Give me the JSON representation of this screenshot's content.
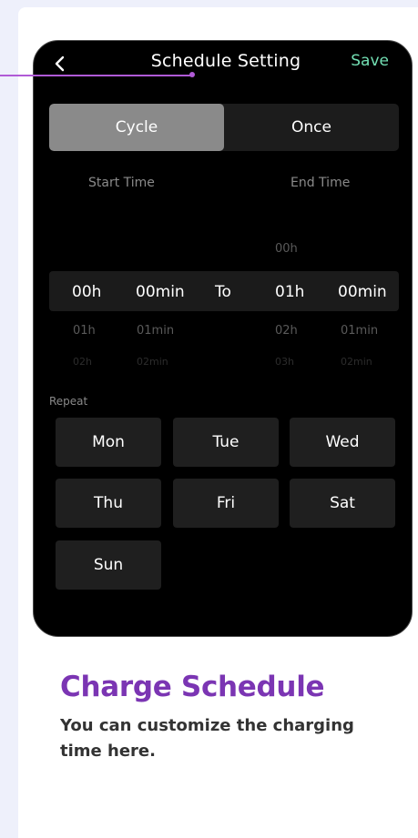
{
  "header": {
    "title": "Schedule Setting",
    "save_label": "Save",
    "back_icon": "chevron-left-icon"
  },
  "mode": {
    "options": [
      "Cycle",
      "Once"
    ],
    "selected": "Cycle"
  },
  "time_columns": {
    "start_label": "Start Time",
    "end_label": "End Time",
    "separator": "To"
  },
  "start_time": {
    "hour": {
      "selected": "00h",
      "next": "01h",
      "next2": "02h"
    },
    "minute": {
      "selected": "00min",
      "next": "01min",
      "next2": "02min"
    }
  },
  "end_time": {
    "hour": {
      "prev": "00h",
      "selected": "01h",
      "next": "02h",
      "next2": "03h"
    },
    "minute": {
      "selected": "00min",
      "next": "01min",
      "next2": "02min"
    }
  },
  "repeat": {
    "label": "Repeat",
    "days": [
      "Mon",
      "Tue",
      "Wed",
      "Thu",
      "Fri",
      "Sat",
      "Sun"
    ]
  },
  "caption": {
    "heading": "Charge Schedule",
    "description": "You can customize the charging time here."
  },
  "colors": {
    "accent_purple": "#7b35b3",
    "save_green": "#73e0b4",
    "active_toggle": "#8a8a8a"
  }
}
